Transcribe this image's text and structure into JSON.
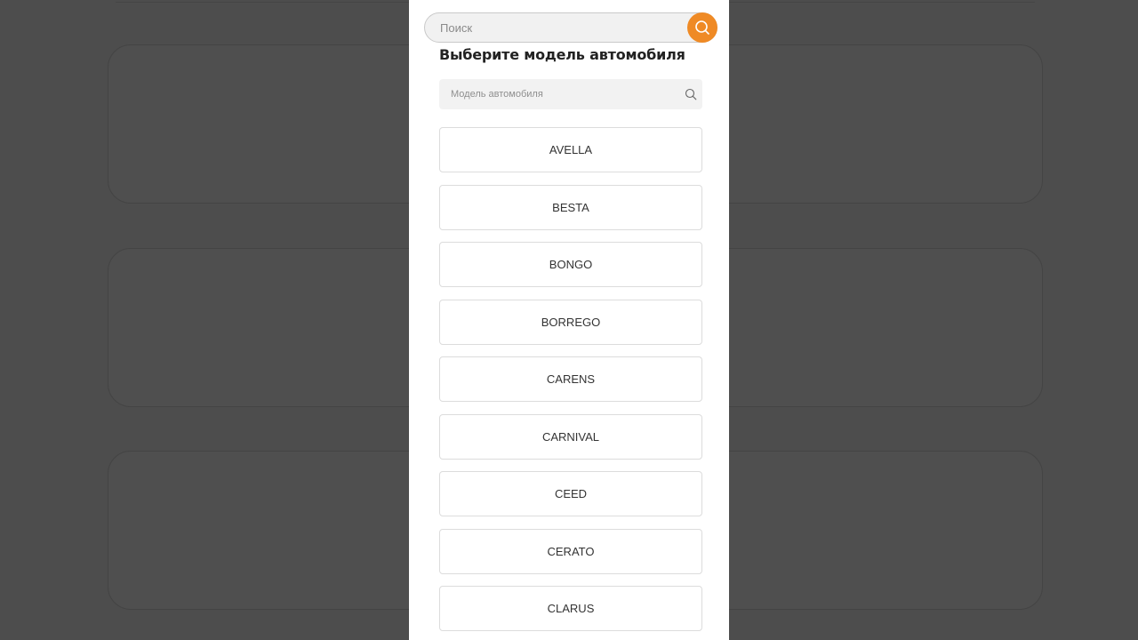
{
  "header": {
    "search_placeholder": "Поиск",
    "search_button_icon": "search-icon"
  },
  "modal": {
    "title": "Выберите модель автомобиля",
    "model_search_placeholder": "Модель автомобиля",
    "model_search_icon": "search-icon"
  },
  "models": [
    "AVELLA",
    "BESTA",
    "BONGO",
    "BORREGO",
    "CARENS",
    "CARNIVAL",
    "CEED",
    "CERATO",
    "CLARUS"
  ],
  "colors": {
    "accent": "#ef8a25",
    "overlay": "#4d4d4d",
    "panel": "#ffffff"
  }
}
